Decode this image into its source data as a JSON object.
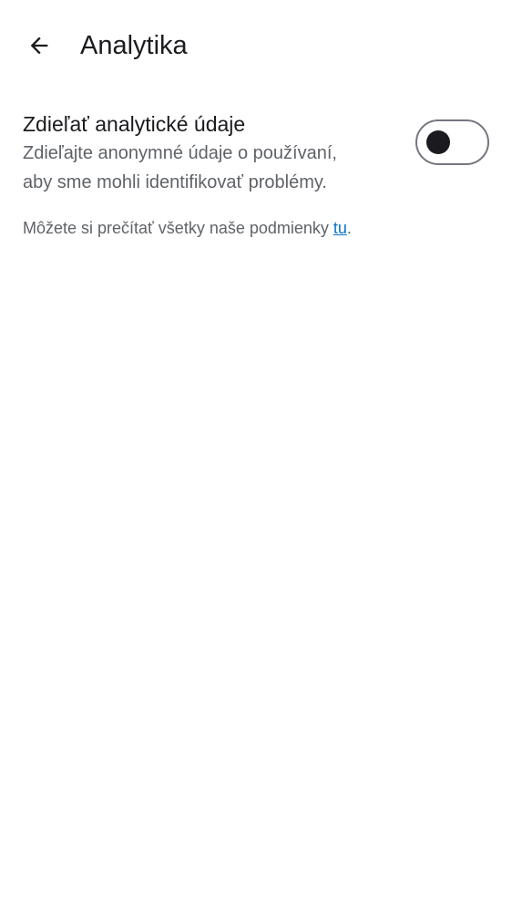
{
  "app_bar": {
    "back_icon": "arrow-back-icon",
    "title": "Analytika"
  },
  "analytics_setting": {
    "title": "Zdieľať analytické údaje",
    "description_line1": "Zdieľajte anonymné údaje o používaní,",
    "description_line2": "aby sme mohli identifikovať problémy.",
    "toggle_on": false
  },
  "footer": {
    "text": "Môžete si prečítať všetky naše podmienky ",
    "link_text": "tu",
    "suffix": "."
  },
  "colors": {
    "text_primary": "#1b1b1f",
    "text_secondary": "#5f6368",
    "link": "#0b73c6",
    "toggle_outline": "#74777f"
  }
}
